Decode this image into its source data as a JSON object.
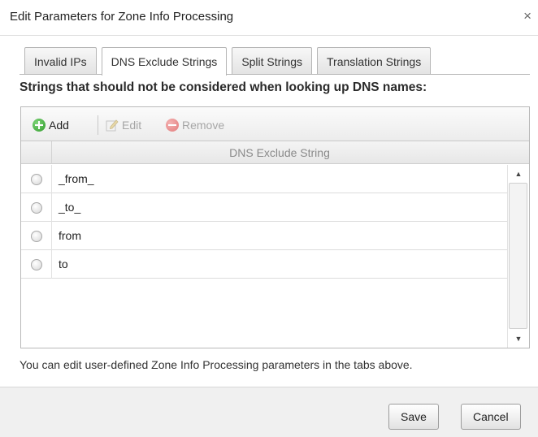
{
  "window": {
    "title": "Edit Parameters for Zone Info Processing",
    "close_glyph": "×"
  },
  "tabs": [
    {
      "label": "Invalid IPs",
      "active": false
    },
    {
      "label": "DNS Exclude Strings",
      "active": true
    },
    {
      "label": "Split Strings",
      "active": false
    },
    {
      "label": "Translation Strings",
      "active": false
    }
  ],
  "heading": "Strings that should not be considered when looking up DNS names:",
  "toolbar": {
    "add_label": "Add",
    "add_icon": "add-icon",
    "edit_label": "Edit",
    "edit_icon": "edit-icon",
    "remove_label": "Remove",
    "remove_icon": "remove-icon"
  },
  "table": {
    "column_header": "DNS Exclude String",
    "rows": [
      "_from_",
      "_to_",
      "from",
      "to"
    ]
  },
  "hint": "You can edit user-defined Zone Info Processing parameters in the tabs above.",
  "buttons": {
    "save": "Save",
    "cancel": "Cancel"
  },
  "colors": {
    "add_icon": "#2f9a2a",
    "remove_icon": "#e27a7a",
    "disabled_text": "#a6a6a6"
  }
}
